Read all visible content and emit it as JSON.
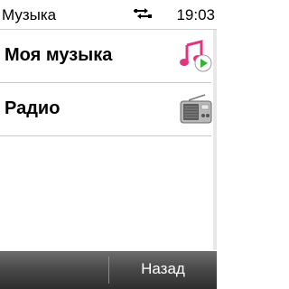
{
  "status_bar": {
    "title": "Музыка",
    "time": "19:03",
    "connection_icon": "usb-icon"
  },
  "menu": {
    "items": [
      {
        "label": "Моя музыка",
        "icon": "music-library-icon"
      },
      {
        "label": "Радио",
        "icon": "radio-icon"
      }
    ]
  },
  "softkeys": {
    "right_label": "Назад"
  },
  "colors": {
    "background": "#ffffff",
    "softkey_bar": "#3c3c3c",
    "music_note": "#e0357f",
    "play_green": "#2fb52f"
  }
}
